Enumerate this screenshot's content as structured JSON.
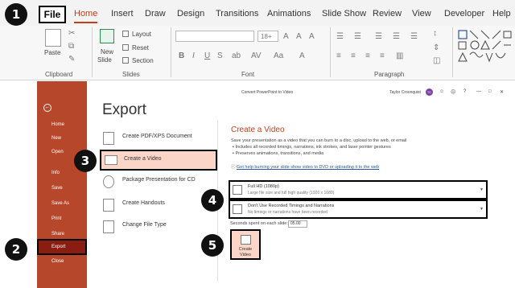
{
  "ribbon": {
    "tabs": [
      "File",
      "Home",
      "Insert",
      "Draw",
      "Design",
      "Transitions",
      "Animations",
      "Slide Show",
      "Review",
      "View",
      "Developer",
      "Help"
    ],
    "groups": {
      "clipboard": "Clipboard",
      "slides": "Slides",
      "font": "Font",
      "paragraph": "Paragraph"
    },
    "paste": "Paste",
    "new_slide_1": "New",
    "new_slide_2": "Slide",
    "layout": "Layout",
    "reset": "Reset",
    "section": "Section",
    "font_size": "18+"
  },
  "window": {
    "title": "Convert PowerPoint to Video",
    "user": "Taylor Croonquist",
    "user_initials": "TC",
    "controls": [
      "☺",
      "☹",
      "?",
      "—",
      "□",
      "✕"
    ]
  },
  "sidebar": {
    "items": [
      "Home",
      "New",
      "Open",
      "Info",
      "Save",
      "Save As",
      "Print",
      "Share",
      "Export",
      "Close"
    ]
  },
  "export": {
    "title": "Export",
    "options": [
      "Create PDF/XPS Document",
      "Create a Video",
      "Package Presentation for CD",
      "Create Handouts",
      "Change File Type"
    ]
  },
  "video": {
    "title": "Create a Video",
    "desc": "Save your presentation as a video that you can burn to a disc, upload to the web, or email",
    "bullets": [
      "Includes all recorded timings, narrations, ink strokes, and laser pointer gestures",
      "Preserves animations, transitions, and media"
    ],
    "help_link": "Get help burning your slide show video to DVD or uploading it to the web",
    "quality_title": "Full HD (1080p)",
    "quality_sub": "Large file size and full high quality (1920 x 1080)",
    "timings_title": "Don't Use Recorded Timings and Narrations",
    "timings_sub": "No timings or narrations have been recorded",
    "seconds_label": "Seconds spent on each slide:",
    "seconds_value": "05.00",
    "button_1": "Create",
    "button_2": "Video"
  },
  "steps": [
    "1",
    "2",
    "3",
    "4",
    "5"
  ]
}
